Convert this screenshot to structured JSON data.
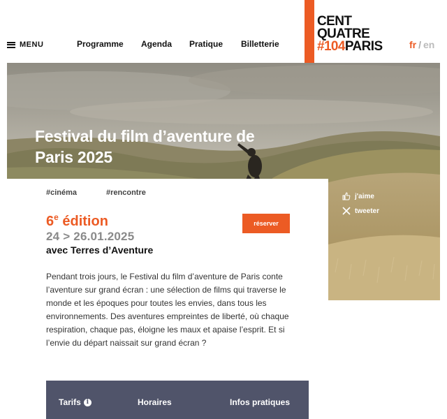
{
  "header": {
    "menu_label": "MENU",
    "nav": [
      "Programme",
      "Agenda",
      "Pratique",
      "Billetterie"
    ],
    "logo": {
      "line1": "CENT",
      "line2": "QUATRE",
      "hash": "#104",
      "city": "PARIS"
    },
    "lang": {
      "active": "fr",
      "separator": "/",
      "other": "en"
    }
  },
  "hero": {
    "title_line1": "Festival du film d’aventure de",
    "title_line2": "Paris 2025",
    "share": {
      "like": "j'aime",
      "tweet": "tweeter"
    }
  },
  "event": {
    "tags": [
      "#cinéma",
      "#rencontre"
    ],
    "edition_number": "6",
    "edition_sup": "e",
    "edition_word": " édition",
    "dates": "24 > 26.01.2025",
    "partner": "avec Terres d’Aventure",
    "reserve_label": "réserver",
    "description": "Pendant trois jours, le Festival du film d’aventure de Paris conte l’aventure sur grand écran : une sélection de films qui traverse le monde et les époques pour toutes les envies, dans tous les environnements. Des aventures empreintes de liberté, où chaque respiration, chaque pas, éloigne les maux et apaise l’esprit. Et si l’envie du départ naissait sur grand écran ?"
  },
  "info_bar": {
    "tarifs": "Tarifs",
    "horaires": "Horaires",
    "infos": "Infos pratiques"
  },
  "colors": {
    "accent": "#ec5b24",
    "info_bar": "#50546a"
  }
}
